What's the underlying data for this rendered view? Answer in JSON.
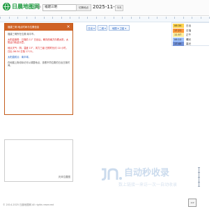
{
  "header": {
    "logo_text": "日晨地图网",
    "logo_suffix": "提示",
    "place_value": "福建三明",
    "tool_label": "切换地点",
    "date_value": "2025-11-28",
    "today_label": "今天"
  },
  "panel": {
    "title": "福建三明  地点时间与位置信息",
    "close": "×",
    "paragraphs": [
      "福建三明所在位置 南平市。",
      "太阳高度角：日落前 11° 日出后，朝向西南方向看太阳，太阳运行轨迹示意。",
      "地点天气：阴，温度 15°，风力三级 日照时长约 10 小时，日出 06:34 日落 17:21。",
      "太阳直射点：南半球。",
      "在地图上拖动标记可以调整地点，查看不同位置的日出日落时间。"
    ]
  },
  "controls": {
    "btn1": "日出 ▾",
    "btn2": "二维 ▾",
    "btn3": "地图 ▾ 卫星 ▾"
  },
  "legend": {
    "items": [
      {
        "time": "06:34",
        "label": "日出",
        "color": "#ffd34d"
      },
      {
        "time": "17:21",
        "label": "日落",
        "color": "#ff9a3a"
      },
      {
        "time": "11:57",
        "label": "正午",
        "color": "#ffef9e"
      },
      {
        "time": "06:10",
        "label": "曙光",
        "color": "#9ec2ff"
      },
      {
        "time": "17:45",
        "label": "暮光",
        "color": "#6f8fd6"
      }
    ]
  },
  "smallmap": {
    "label": "天体位置图"
  },
  "watermark": {
    "title": "自动秒收录",
    "sub": "数上链接一来访一次一自动收录"
  },
  "footer": {
    "text": "© 2014-2025 日晨地图网 All rights reserved"
  },
  "badge": {
    "text": "ICP"
  },
  "colors": {
    "brand": "#1d9a3f",
    "panel_accent": "#d06224",
    "link": "#1d5fc4"
  }
}
